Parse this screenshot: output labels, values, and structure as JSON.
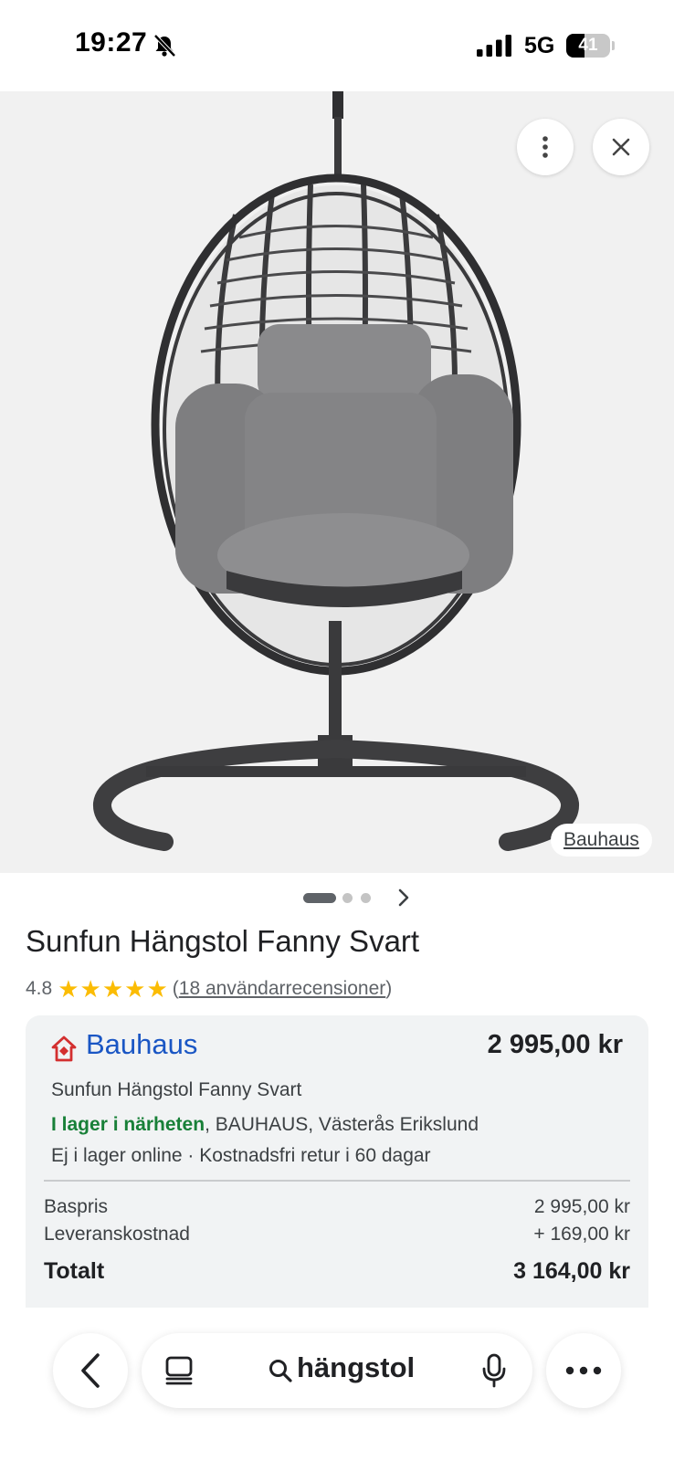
{
  "status_bar": {
    "time": "19:27",
    "network": "5G",
    "battery_percent": "41",
    "battery_level": 0.41
  },
  "image_viewer": {
    "source_label": "Bauhaus",
    "carousel": {
      "total": 3,
      "active_index": 0
    }
  },
  "product": {
    "title": "Sunfun Hängstol Fanny Svart",
    "rating": "4.8",
    "stars": 5,
    "reviews_prefix": "(",
    "reviews_link": "18 användarrecensioner",
    "reviews_suffix": ")"
  },
  "offer": {
    "merchant": "Bauhaus",
    "price": "2 995,00 kr",
    "product_name": "Sunfun Hängstol Fanny Svart",
    "stock_status": "I lager i närheten",
    "stock_location": ", BAUHAUS, Västerås Erikslund",
    "delivery_info": "Ej i lager online · Kostnadsfri retur i 60 dagar",
    "breakdown": {
      "base_label": "Baspris",
      "base_value": "2 995,00 kr",
      "shipping_label": "Leveranskostnad",
      "shipping_value": "+ 169,00 kr",
      "total_label": "Totalt",
      "total_value": "3 164,00 kr"
    }
  },
  "toolbar": {
    "search_query": "hängstol"
  },
  "colors": {
    "link_blue": "#1a56c4",
    "stock_green": "#188038",
    "star_yellow": "#fbbc04"
  }
}
